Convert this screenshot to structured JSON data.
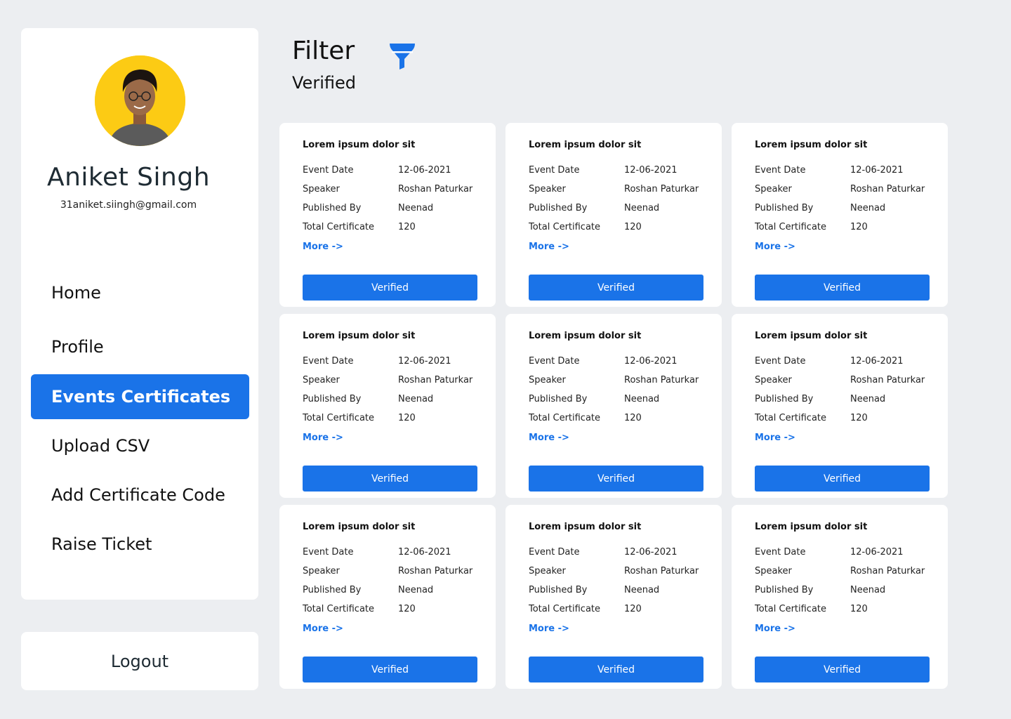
{
  "user": {
    "name": "Aniket Singh",
    "email": "31aniket.siingh@gmail.com"
  },
  "nav": [
    {
      "label": "Home",
      "active": false
    },
    {
      "label": "Profile",
      "active": false
    },
    {
      "label": "Events Certificates",
      "active": true
    },
    {
      "label": "Upload CSV",
      "active": false
    },
    {
      "label": "Add Certificate Code",
      "active": false
    },
    {
      "label": "Raise Ticket",
      "active": false
    }
  ],
  "logout_label": "Logout",
  "filter": {
    "title": "Filter",
    "value": "Verified",
    "icon": "funnel-icon"
  },
  "colors": {
    "accent": "#1a73e8",
    "background": "#eceef1",
    "avatar_bg": "#fccb14"
  },
  "cards": [
    {
      "title": "Lorem ipsum dolor sit",
      "fields": [
        [
          "Event Date",
          "12-06-2021"
        ],
        [
          "Speaker",
          "Roshan Paturkar"
        ],
        [
          "Published By",
          "Neenad"
        ],
        [
          "Total Certificate",
          "120"
        ]
      ],
      "more": "More ->",
      "button": "Verified"
    },
    {
      "title": "Lorem ipsum dolor sit",
      "fields": [
        [
          "Event Date",
          "12-06-2021"
        ],
        [
          "Speaker",
          "Roshan Paturkar"
        ],
        [
          "Published By",
          "Neenad"
        ],
        [
          "Total Certificate",
          "120"
        ]
      ],
      "more": "More ->",
      "button": "Verified"
    },
    {
      "title": "Lorem ipsum dolor sit",
      "fields": [
        [
          "Event Date",
          "12-06-2021"
        ],
        [
          "Speaker",
          "Roshan Paturkar"
        ],
        [
          "Published By",
          "Neenad"
        ],
        [
          "Total Certificate",
          "120"
        ]
      ],
      "more": "More ->",
      "button": "Verified"
    },
    {
      "title": "Lorem ipsum dolor sit",
      "fields": [
        [
          "Event Date",
          "12-06-2021"
        ],
        [
          "Speaker",
          "Roshan Paturkar"
        ],
        [
          "Published By",
          "Neenad"
        ],
        [
          "Total Certificate",
          "120"
        ]
      ],
      "more": "More ->",
      "button": "Verified"
    },
    {
      "title": "Lorem ipsum dolor sit",
      "fields": [
        [
          "Event Date",
          "12-06-2021"
        ],
        [
          "Speaker",
          "Roshan Paturkar"
        ],
        [
          "Published By",
          "Neenad"
        ],
        [
          "Total Certificate",
          "120"
        ]
      ],
      "more": "More ->",
      "button": "Verified"
    },
    {
      "title": "Lorem ipsum dolor sit",
      "fields": [
        [
          "Event Date",
          "12-06-2021"
        ],
        [
          "Speaker",
          "Roshan Paturkar"
        ],
        [
          "Published By",
          "Neenad"
        ],
        [
          "Total Certificate",
          "120"
        ]
      ],
      "more": "More ->",
      "button": "Verified"
    },
    {
      "title": "Lorem ipsum dolor sit",
      "fields": [
        [
          "Event Date",
          "12-06-2021"
        ],
        [
          "Speaker",
          "Roshan Paturkar"
        ],
        [
          "Published By",
          "Neenad"
        ],
        [
          "Total Certificate",
          "120"
        ]
      ],
      "more": "More ->",
      "button": "Verified"
    },
    {
      "title": "Lorem ipsum dolor sit",
      "fields": [
        [
          "Event Date",
          "12-06-2021"
        ],
        [
          "Speaker",
          "Roshan Paturkar"
        ],
        [
          "Published By",
          "Neenad"
        ],
        [
          "Total Certificate",
          "120"
        ]
      ],
      "more": "More ->",
      "button": "Verified"
    },
    {
      "title": "Lorem ipsum dolor sit",
      "fields": [
        [
          "Event Date",
          "12-06-2021"
        ],
        [
          "Speaker",
          "Roshan Paturkar"
        ],
        [
          "Published By",
          "Neenad"
        ],
        [
          "Total Certificate",
          "120"
        ]
      ],
      "more": "More ->",
      "button": "Verified"
    }
  ]
}
